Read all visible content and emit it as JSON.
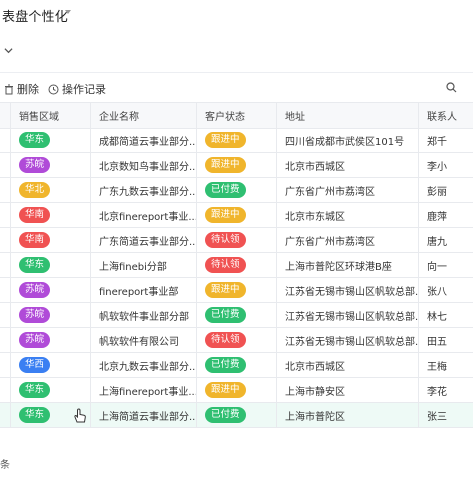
{
  "header": {
    "title": "表盘个性化"
  },
  "toolbar": {
    "delete_label": "删除",
    "log_label": "操作记录"
  },
  "columns": [
    "销售区域",
    "企业名称",
    "客户状态",
    "地址",
    "联系人"
  ],
  "colors": {
    "区域": {
      "华东": "#2fbf71",
      "苏皖": "#b04bd8",
      "华北": "#f0b52c",
      "华南": "#f05252",
      "华西": "#3a7ff2"
    },
    "状态": {
      "跟进中": "#f0b52c",
      "已付费": "#2fbf71",
      "待认领": "#f05252"
    }
  },
  "rows": [
    {
      "region": "华东",
      "company": "成都简道云事业部分...",
      "status": "跟进中",
      "address": "四川省成都市武侯区101号",
      "contact": "郑千"
    },
    {
      "region": "苏皖",
      "company": "北京数知鸟事业部分...",
      "status": "跟进中",
      "address": "北京市西城区",
      "contact": "李小"
    },
    {
      "region": "华北",
      "company": "广东九数云事业部分...",
      "status": "已付费",
      "address": "广东省广州市荔湾区",
      "contact": "彭丽"
    },
    {
      "region": "华南",
      "company": "北京finereport事业...",
      "status": "跟进中",
      "address": "北京市东城区",
      "contact": "鹿萍"
    },
    {
      "region": "华南",
      "company": "广东简道云事业部分...",
      "status": "待认领",
      "address": "广东省广州市荔湾区",
      "contact": "唐九"
    },
    {
      "region": "华东",
      "company": "上海finebi分部",
      "status": "待认领",
      "address": "上海市普陀区环球港B座",
      "contact": "向一"
    },
    {
      "region": "苏皖",
      "company": "finereport事业部",
      "status": "跟进中",
      "address": "江苏省无锡市锡山区帆软总部...",
      "contact": "张八"
    },
    {
      "region": "苏皖",
      "company": "帆软软件事业部分部",
      "status": "已付费",
      "address": "江苏省无锡市锡山区帆软总部...",
      "contact": "林七"
    },
    {
      "region": "苏皖",
      "company": "帆软软件有限公司",
      "status": "待认领",
      "address": "江苏省无锡市锡山区帆软总部...",
      "contact": "田五"
    },
    {
      "region": "华西",
      "company": "北京九数云事业部分...",
      "status": "已付费",
      "address": "北京市西城区",
      "contact": "王梅"
    },
    {
      "region": "华东",
      "company": "上海finereport事业...",
      "status": "跟进中",
      "address": "上海市静安区",
      "contact": "李花"
    },
    {
      "region": "华东",
      "company": "上海简道云事业部分...",
      "status": "已付费",
      "address": "上海市普陀区",
      "contact": "张三"
    }
  ],
  "footer": {
    "text": "条"
  }
}
